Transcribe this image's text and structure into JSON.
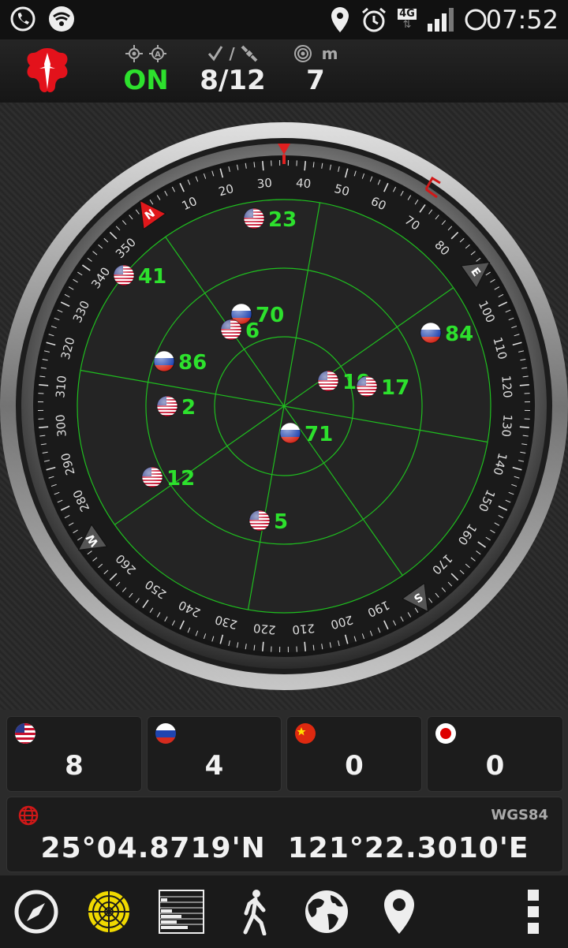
{
  "statusbar": {
    "time": "07:52",
    "network_badge": "4G",
    "icons": [
      "phone-icon",
      "wifi-icon",
      "location-icon",
      "alarm-icon",
      "network-4g-icon",
      "signal-icon",
      "battery-icon"
    ]
  },
  "header": {
    "fix_status": "ON",
    "sats_used": "8",
    "sats_sep": "/",
    "sats_visible": "12",
    "accuracy": "7",
    "accuracy_unit": "m",
    "colors": {
      "on": "#2de12d",
      "text": "#eeeeee"
    }
  },
  "compass": {
    "cardinals": [
      "N",
      "E",
      "S",
      "W"
    ],
    "degree_labels": [
      "10",
      "20",
      "30",
      "40",
      "50",
      "60",
      "70",
      "80",
      "100",
      "110",
      "120",
      "130",
      "140",
      "150",
      "160",
      "170",
      "190",
      "200",
      "210",
      "220",
      "230",
      "240",
      "250",
      "260",
      "280",
      "290",
      "300",
      "310",
      "320",
      "330",
      "340",
      "350"
    ],
    "satellites": [
      {
        "id": "23",
        "flag": "us"
      },
      {
        "id": "41",
        "flag": "us"
      },
      {
        "id": "70",
        "flag": "ru"
      },
      {
        "id": "6",
        "flag": "us"
      },
      {
        "id": "84",
        "flag": "ru"
      },
      {
        "id": "86",
        "flag": "ru"
      },
      {
        "id": "19",
        "flag": "us"
      },
      {
        "id": "17",
        "flag": "us"
      },
      {
        "id": "2",
        "flag": "us"
      },
      {
        "id": "71",
        "flag": "ru"
      },
      {
        "id": "12",
        "flag": "us"
      },
      {
        "id": "5",
        "flag": "us"
      }
    ]
  },
  "constellations": [
    {
      "name": "gps",
      "flag": "us",
      "count": "8"
    },
    {
      "name": "glonass",
      "flag": "ru",
      "count": "4"
    },
    {
      "name": "beidou",
      "flag": "cn",
      "count": "0"
    },
    {
      "name": "qzss",
      "flag": "jp",
      "count": "0"
    }
  ],
  "coordinates": {
    "datum": "WGS84",
    "lat": "25°04.8719'N",
    "lon": "121°22.3010'E"
  },
  "toolbar": {
    "items": [
      "compass-icon",
      "radar-icon",
      "signal-bars-icon",
      "walker-icon",
      "globe-icon",
      "map-pin-icon",
      "overflow-menu-icon"
    ]
  }
}
